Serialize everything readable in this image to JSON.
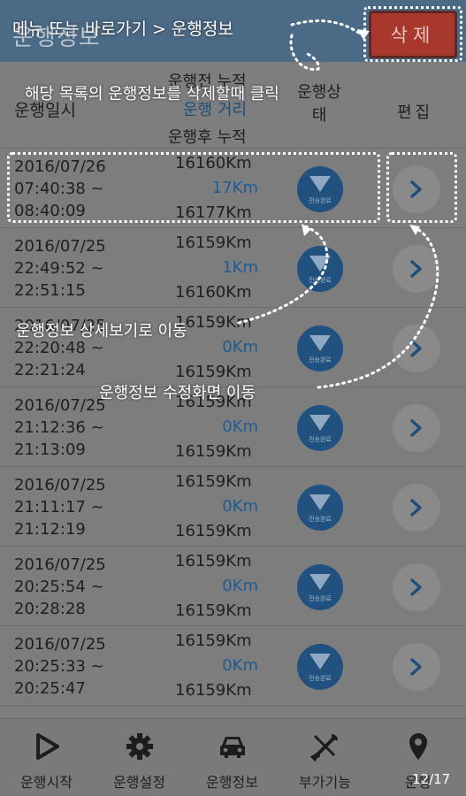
{
  "header": {
    "title": "운행정보",
    "delete_button": "삭제"
  },
  "columns": {
    "date": "운행일시",
    "before": "운행전 누적",
    "distance": "운행 거리",
    "after": "운행후 누적",
    "status": "운행상태",
    "edit": "편집"
  },
  "rows": [
    {
      "date": "2016/07/26\n07:40:38 ~\n08:40:09",
      "before": "16160Km",
      "distance": "17Km",
      "after": "16177Km"
    },
    {
      "date": "2016/07/25\n22:49:52 ~\n22:51:15",
      "before": "16159Km",
      "distance": "1Km",
      "after": "16160Km"
    },
    {
      "date": "2016/07/25\n22:20:48 ~\n22:21:24",
      "before": "16159Km",
      "distance": "0Km",
      "after": "16159Km"
    },
    {
      "date": "2016/07/25\n21:12:36 ~\n21:13:09",
      "before": "16159Km",
      "distance": "0Km",
      "after": "16159Km"
    },
    {
      "date": "2016/07/25\n21:11:17 ~\n21:12:19",
      "before": "16159Km",
      "distance": "0Km",
      "after": "16159Km"
    },
    {
      "date": "2016/07/25\n20:25:54 ~\n20:28:28",
      "before": "16159Km",
      "distance": "0Km",
      "after": "16159Km"
    },
    {
      "date": "2016/07/25\n20:25:33 ~\n20:25:47",
      "before": "16159Km",
      "distance": "0Km",
      "after": "16159Km"
    }
  ],
  "status_icon_label": "전송완료",
  "nav": [
    {
      "label": "운행시작",
      "icon": "play-icon"
    },
    {
      "label": "운행설정",
      "icon": "gear-icon"
    },
    {
      "label": "운행정보",
      "icon": "car-icon"
    },
    {
      "label": "부가기능",
      "icon": "tools-icon"
    },
    {
      "label": "운행",
      "icon": "location-pin-icon"
    }
  ],
  "page_counter": "12/17",
  "annotations": {
    "menu_path": "메뉴 또는 바로가기 > 운행정보",
    "delete_hint": "해당 목록의 운행정보를 삭제할때 클릭",
    "detail_hint": "운행정보 상세보기로 이동",
    "edit_hint": "운행정보 수정화면 이동"
  },
  "colors": {
    "topbar": "#4a6a86",
    "delete": "#a8372e",
    "status_circle": "#21527f",
    "distance_text": "#1f5c96"
  }
}
